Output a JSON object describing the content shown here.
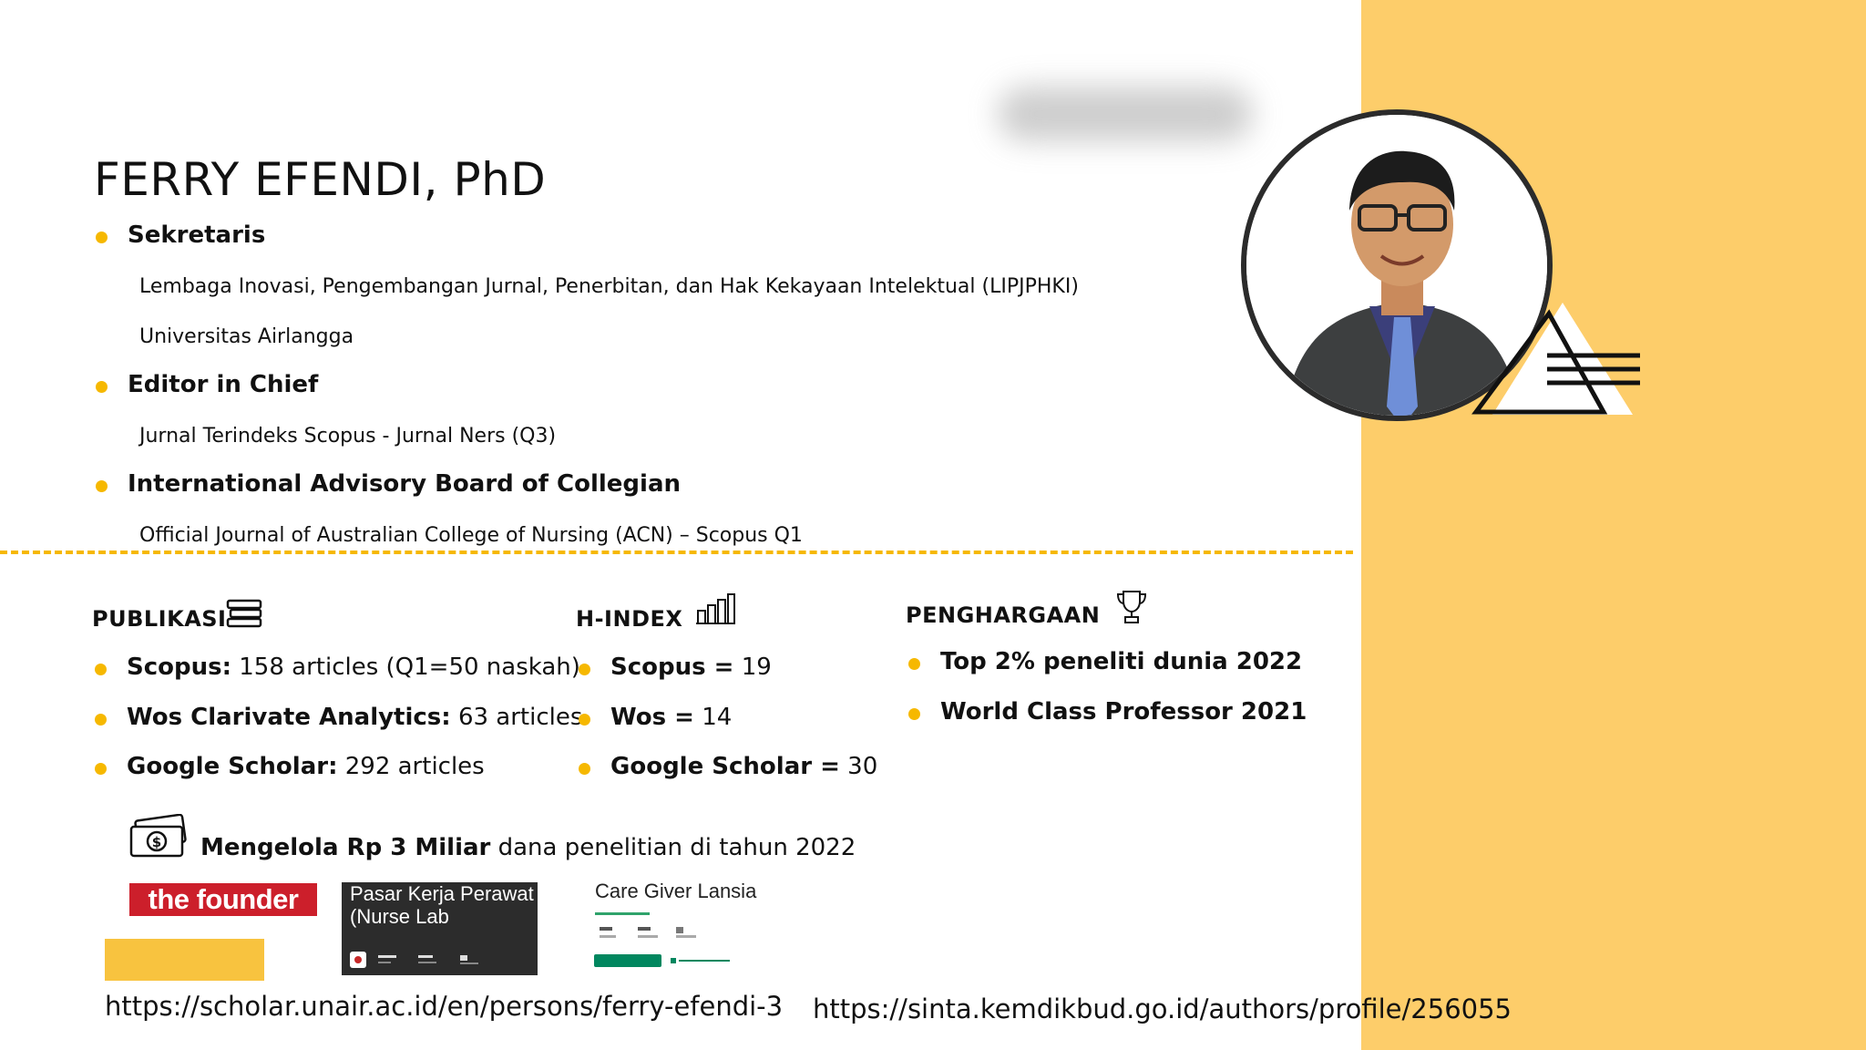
{
  "profile": {
    "name": "FERRY EFENDI, PhD",
    "roles": [
      {
        "title": "Sekretaris",
        "details": [
          "Lembaga Inovasi, Pengembangan Jurnal, Penerbitan, dan Hak Kekayaan Intelektual (LIPJPHKI)",
          "Universitas Airlangga"
        ]
      },
      {
        "title": "Editor in Chief",
        "details": [
          "Jurnal Terindeks Scopus - Jurnal Ners (Q3)"
        ]
      },
      {
        "title": "International Advisory Board of Collegian",
        "details": [
          "Official Journal of Australian College of Nursing (ACN) – Scopus Q1"
        ]
      }
    ]
  },
  "publikasi": {
    "heading": "PUBLIKASI",
    "icon": "books-icon",
    "items": [
      {
        "label": "Scopus:",
        "value": " 158 articles (Q1=50 naskah)"
      },
      {
        "label": "Wos Clarivate Analytics:",
        "value": " 63 articles"
      },
      {
        "label": "Google Scholar:",
        "value": " 292 articles"
      }
    ]
  },
  "hindex": {
    "heading": "H-INDEX",
    "icon": "bar-chart-icon",
    "items": [
      {
        "label": "Scopus =",
        "value": " 19"
      },
      {
        "label": "Wos =",
        "value": " 14"
      },
      {
        "label": "Google Scholar =",
        "value": " 30"
      }
    ]
  },
  "penghargaan": {
    "heading": "PENGHARGAAN",
    "icon": "trophy-icon",
    "items": [
      "Top 2% peneliti dunia 2022",
      "World Class Professor 2021"
    ]
  },
  "funding": {
    "icon": "money-icon",
    "bold": "Mengelola Rp 3 Miliar",
    "rest": " dana penelitian di tahun 2022"
  },
  "apps": {
    "founder_logo": "the founder",
    "nurse_app_title_1": "Pasar Kerja Perawat",
    "nurse_app_title_2": "(Nurse Lab",
    "caregiver_title": "Care Giver Lansia"
  },
  "links": {
    "scholar_url": "https://scholar.unair.ac.id/en/persons/ferry-efendi-3",
    "sinta_url": "https://sinta.kemdikbud.go.id/authors/profile/256055"
  },
  "colors": {
    "accent_yellow": "#f6b800",
    "panel_yellow": "#fdcd6a",
    "founder_red": "#cc1f2b"
  }
}
